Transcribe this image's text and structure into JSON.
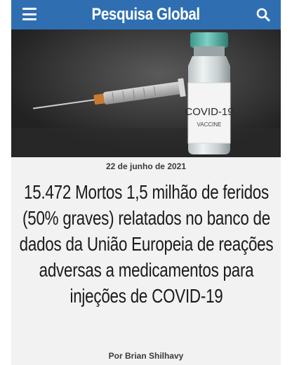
{
  "header": {
    "site_title": "Pesquisa Global",
    "menu_icon": "hamburger-menu-icon",
    "search_icon": "search-icon",
    "bar_color": "#2f6fb1"
  },
  "hero": {
    "vial_label_line1": "COVID-19",
    "vial_label_line2": "VACCINE",
    "cap_color": "#5bb3a8"
  },
  "article": {
    "date": "22 de junho de 2021",
    "headline": "15.472 Mortos 1,5 milhão de feridos (50% graves) relatados no banco de dados da União Europeia de reações adversas a medicamentos para injeções de COVID-19",
    "author": "Por Brian Shilhavy"
  }
}
